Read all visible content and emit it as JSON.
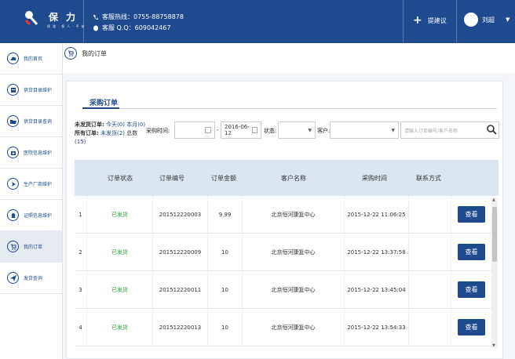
{
  "brand": {
    "name": "保力",
    "sub": "保道·保人·平安"
  },
  "header": {
    "hotline": "客服热线：0755-88758878",
    "qq": "客服 Q.Q：609042467",
    "suggest_label": "提建议",
    "user_name": "刘超"
  },
  "sidebar": {
    "items": [
      {
        "label": "我的首页",
        "icon": "cloud-icon"
      },
      {
        "label": "供货目录维护",
        "icon": "file-edit-icon"
      },
      {
        "label": "供货目录查询",
        "icon": "folder-icon"
      },
      {
        "label": "医院信息维护",
        "icon": "hospital-icon"
      },
      {
        "label": "生产厂商维护",
        "icon": "arrow-right-icon"
      },
      {
        "label": "证照信息维护",
        "icon": "bell-icon"
      },
      {
        "label": "我的订单",
        "icon": "cart-icon",
        "active": true
      },
      {
        "label": "发货查询",
        "icon": "send-icon"
      }
    ]
  },
  "breadcrumb": "我的订单",
  "tab": "采购订单",
  "summary": {
    "unshipped_label": "未发货订单:",
    "unshipped_today": "今天(0)",
    "unshipped_month": "本月(0)",
    "all_label": "所有订单:",
    "all_unshipped": "未发货(2)",
    "total_label": "总数",
    "total_count": "(15)"
  },
  "filters": {
    "purchase_time_label": "采购时间:",
    "date_from": "",
    "date_sep": "-",
    "date_to": "2016-06-12",
    "status_label": "状态:",
    "status_value": "",
    "customer_label": "客户:",
    "customer_value": "",
    "search_placeholder": "请输入订单编号/客户名称"
  },
  "table": {
    "headers": [
      "订单状态",
      "订单编号",
      "订单金额",
      "客户名称",
      "采购时间",
      "联系方式"
    ],
    "view_label": "查看",
    "rows": [
      {
        "idx": "1",
        "status": "已发货",
        "no": "201512220003",
        "amount": "9.99",
        "customer": "北京恒河康复中心",
        "time": "2015-12-22 11:06:25",
        "contact": ""
      },
      {
        "idx": "2",
        "status": "已发货",
        "no": "201512220009",
        "amount": "10",
        "customer": "北京恒河康复中心",
        "time": "2015-12-22 13:37:58",
        "contact": ""
      },
      {
        "idx": "3",
        "status": "已发货",
        "no": "201512220011",
        "amount": "10",
        "customer": "北京恒河康复中心",
        "time": "2015-12-22 13:45:04",
        "contact": ""
      },
      {
        "idx": "4",
        "status": "已发货",
        "no": "201512220013",
        "amount": "10",
        "customer": "北京恒河康复中心",
        "time": "2015-12-22 13:54:33",
        "contact": ""
      }
    ]
  }
}
